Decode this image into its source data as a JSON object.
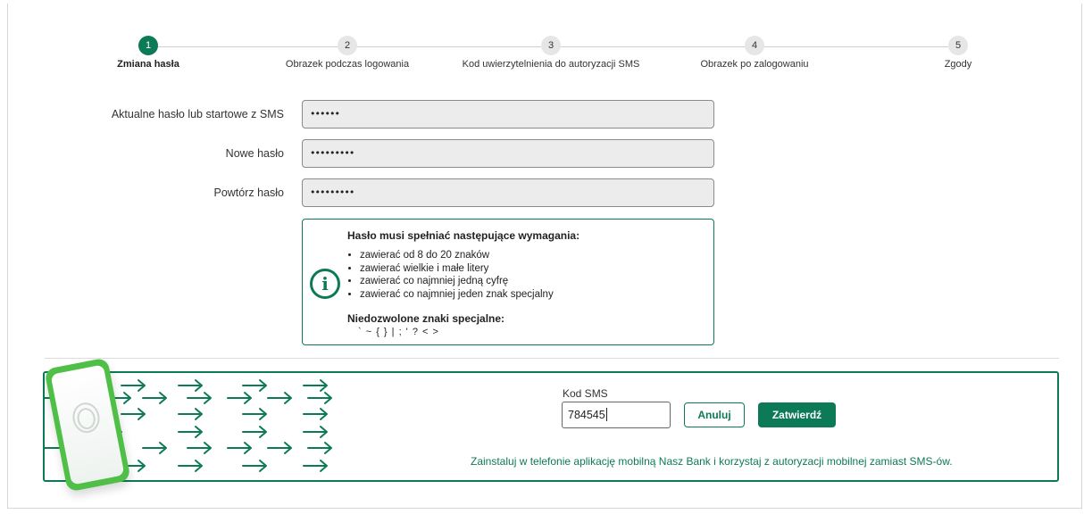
{
  "stepper": {
    "steps": [
      {
        "number": "1",
        "label": "Zmiana hasła",
        "active": true
      },
      {
        "number": "2",
        "label": "Obrazek podczas logowania",
        "active": false
      },
      {
        "number": "3",
        "label": "Kod uwierzytelnienia do autoryzacji SMS",
        "active": false
      },
      {
        "number": "4",
        "label": "Obrazek po zalogowaniu",
        "active": false
      },
      {
        "number": "5",
        "label": "Zgody",
        "active": false
      }
    ]
  },
  "form": {
    "current_label": "Aktualne hasło lub startowe z SMS",
    "current_value": "••••••",
    "new_label": "Nowe hasło",
    "new_value": "•••••••••",
    "repeat_label": "Powtórz hasło",
    "repeat_value": "•••••••••"
  },
  "requirements": {
    "icon": "info-icon",
    "title": "Hasło musi spełniać następujące wymagania:",
    "items": [
      "zawierać od 8 do 20 znaków",
      "zawierać wielkie i małe litery",
      "zawierać co najmniej jedną cyfrę",
      "zawierać co najmniej jeden znak specjalny"
    ],
    "forbidden_title": "Niedozwolone znaki specjalne:",
    "forbidden_chars": "` ~ { } | ; ' ? < >"
  },
  "sms": {
    "label": "Kod SMS",
    "value": "784545",
    "cancel_label": "Anuluj",
    "submit_label": "Zatwierdź",
    "promo": "Zainstaluj w telefonie aplikację mobilną Nasz Bank i korzystaj z autoryzacji mobilnej zamiast SMS-ów."
  },
  "colors": {
    "accent": "#0c7a57",
    "phone": "#4fbf47"
  }
}
